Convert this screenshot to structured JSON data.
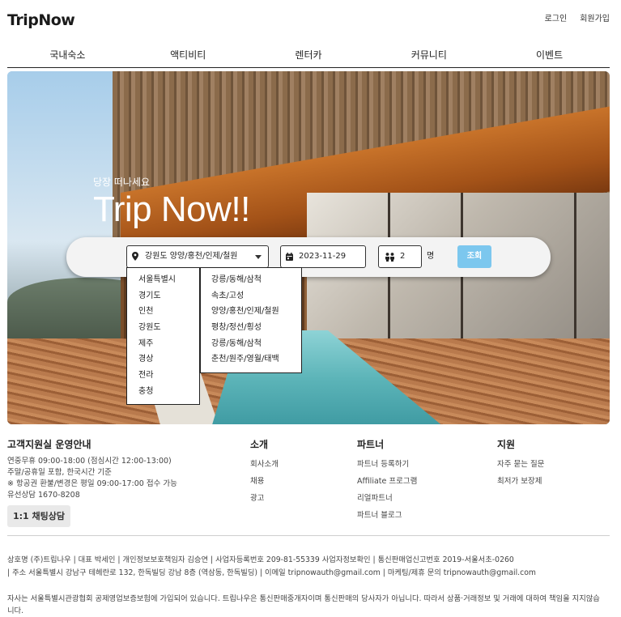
{
  "header": {
    "logo": "TripNow",
    "login": "로그인",
    "signup": "회원가입"
  },
  "nav": {
    "items": [
      "국내숙소",
      "액티비티",
      "렌터카",
      "커뮤니티",
      "이벤트"
    ]
  },
  "hero": {
    "subtitle": "당장 떠나세요",
    "title": "Trip Now!!"
  },
  "search": {
    "region_value": "강원도 양양/홍천/인제/철원",
    "date_value": "2023-11-29",
    "guests_value": "2",
    "guests_unit": "명",
    "submit_label": "조회",
    "accent_color": "#7cc7ee"
  },
  "dropdown": {
    "provinces": [
      "서울특별시",
      "경기도",
      "인천",
      "강원도",
      "제주",
      "경상",
      "전라",
      "충청"
    ],
    "areas": [
      "강릉/동해/삼척",
      "속초/고성",
      "양양/홍천/인제/철원",
      "평창/정선/횡성",
      "강릉/동해/삼척",
      "춘천/원주/영월/태백"
    ]
  },
  "footer": {
    "support": {
      "title": "고객지원실 운영안내",
      "lines": [
        "연중무휴 09:00-18:00 (점심시간 12:00-13:00)",
        "주말/공휴일 포함, 한국시간 기준",
        "※ 항공권 환불/변경은 평일 09:00-17:00 접수 가능",
        "유선상담 1670-8208"
      ],
      "chat_button": "1:1 채팅상담"
    },
    "about": {
      "title": "소개",
      "links": [
        "회사소개",
        "채용",
        "광고"
      ]
    },
    "partners": {
      "title": "파트너",
      "links": [
        "파트너 등록하기",
        "Affiliate 프로그램",
        "리얼파트너",
        "파트너 블로그"
      ]
    },
    "help": {
      "title": "지원",
      "links": [
        "자주 묻는 질문",
        "최저가 보장제"
      ]
    }
  },
  "legal": {
    "line1": "상호명 (주)트립나우 | 대표 박세인 | 개인정보보호책임자 김승연 | 사업자등록번호 209-81-55339 사업자정보확인 | 통신판매업신고번호 2019-서울서초-0260",
    "line2": "| 주소 서울특별시 강남구 테헤란로 132, 한독빌딩 강남 8층 (역삼동, 한독빌딩) | 이메일 tripnowauth@gmail.com | 마케팅/제휴 문의 tripnowauth@gmail.com",
    "note": "자사는 서울특별시관광협회 공제영업보증보험에 가입되어 있습니다. 트립나우은 통신판매중개자이며 통신판매의 당사자가 아닙니다. 따라서 상품·거래정보 및 거래에 대하여 책임을 지지않습니다."
  }
}
